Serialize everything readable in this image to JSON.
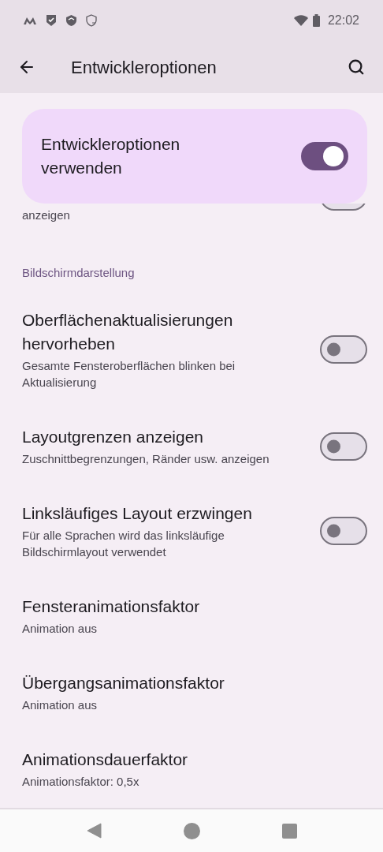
{
  "status_bar": {
    "time": "22:02"
  },
  "toolbar": {
    "title": "Entwickleroptionen"
  },
  "main_switch": {
    "label": "Entwickleroptionen verwenden",
    "on": true
  },
  "partial_row": {
    "summary": "anzeigen",
    "on": false
  },
  "section": {
    "title": "Bildschirmdarstellung"
  },
  "rows": [
    {
      "kind": "switch",
      "title": "Oberflächenaktualisierungen hervorheben",
      "summary": "Gesamte Fensteroberflächen blinken bei Aktualisierung",
      "on": false
    },
    {
      "kind": "switch",
      "title": "Layoutgrenzen anzeigen",
      "summary": "Zuschnittbegrenzungen, Ränder usw. anzeigen",
      "on": false
    },
    {
      "kind": "switch",
      "title": "Linksläufiges Layout erzwingen",
      "summary": "Für alle Sprachen wird das linksläufige Bildschirmlayout verwendet",
      "on": false
    },
    {
      "kind": "plain",
      "title": "Fensteranimationsfaktor",
      "summary": "Animation aus"
    },
    {
      "kind": "plain",
      "title": "Übergangsanimationsfaktor",
      "summary": "Animation aus"
    },
    {
      "kind": "plain",
      "title": "Animationsdauerfaktor",
      "summary": "Animationsfaktor: 0,5x"
    }
  ]
}
